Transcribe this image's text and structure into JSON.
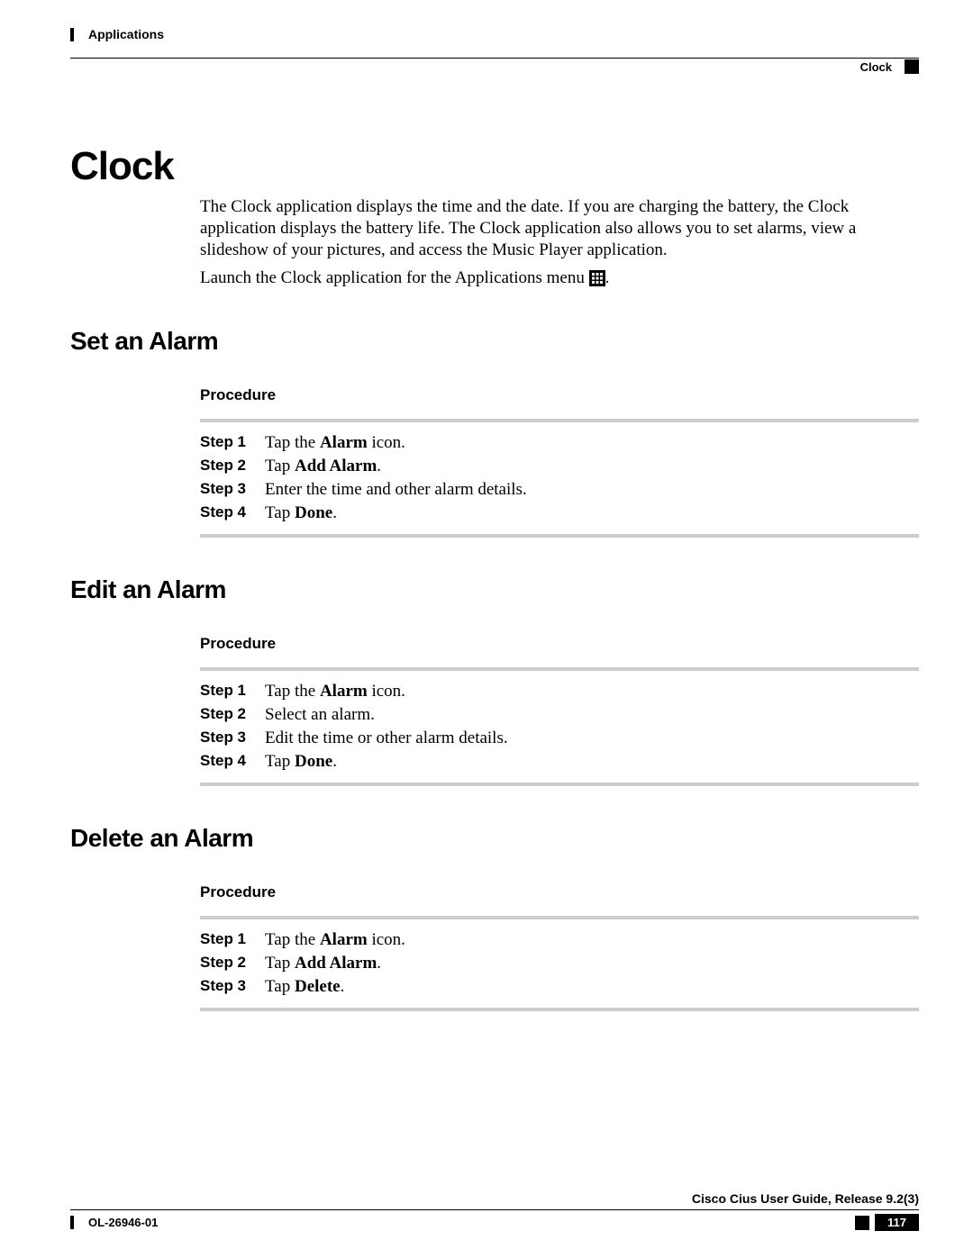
{
  "header": {
    "chapter": "Applications",
    "section": "Clock"
  },
  "title": "Clock",
  "intro": {
    "p1": "The Clock application displays the time and the date. If you are charging the battery, the Clock application displays the battery life. The Clock application also allows you to set alarms, view a slideshow of your pictures, and access the Music Player application.",
    "p2_pre": "Launch the Clock application for the Applications menu ",
    "p2_post": "."
  },
  "icons": {
    "apps_grid": "apps-grid"
  },
  "sections": [
    {
      "heading": "Set an Alarm",
      "procedure_label": "Procedure",
      "steps": [
        {
          "label": "Step 1",
          "parts": [
            "Tap the ",
            {
              "b": "Alarm"
            },
            " icon."
          ]
        },
        {
          "label": "Step 2",
          "parts": [
            "Tap ",
            {
              "b": "Add Alarm"
            },
            "."
          ]
        },
        {
          "label": "Step 3",
          "parts": [
            "Enter the time and other alarm details."
          ]
        },
        {
          "label": "Step 4",
          "parts": [
            "Tap ",
            {
              "b": "Done"
            },
            "."
          ]
        }
      ]
    },
    {
      "heading": "Edit an Alarm",
      "procedure_label": "Procedure",
      "steps": [
        {
          "label": "Step 1",
          "parts": [
            "Tap the ",
            {
              "b": "Alarm"
            },
            " icon."
          ]
        },
        {
          "label": "Step 2",
          "parts": [
            "Select an alarm."
          ]
        },
        {
          "label": "Step 3",
          "parts": [
            "Edit the time or other alarm details."
          ]
        },
        {
          "label": "Step 4",
          "parts": [
            "Tap ",
            {
              "b": "Done"
            },
            "."
          ]
        }
      ]
    },
    {
      "heading": "Delete an Alarm",
      "procedure_label": "Procedure",
      "steps": [
        {
          "label": "Step 1",
          "parts": [
            "Tap the ",
            {
              "b": "Alarm"
            },
            " icon."
          ]
        },
        {
          "label": "Step 2",
          "parts": [
            "Tap ",
            {
              "b": "Add Alarm"
            },
            "."
          ]
        },
        {
          "label": "Step 3",
          "parts": [
            "Tap ",
            {
              "b": "Delete"
            },
            "."
          ]
        }
      ]
    }
  ],
  "footer": {
    "guide": "Cisco Cius User Guide, Release 9.2(3)",
    "doc_id": "OL-26946-01",
    "page": "117"
  }
}
